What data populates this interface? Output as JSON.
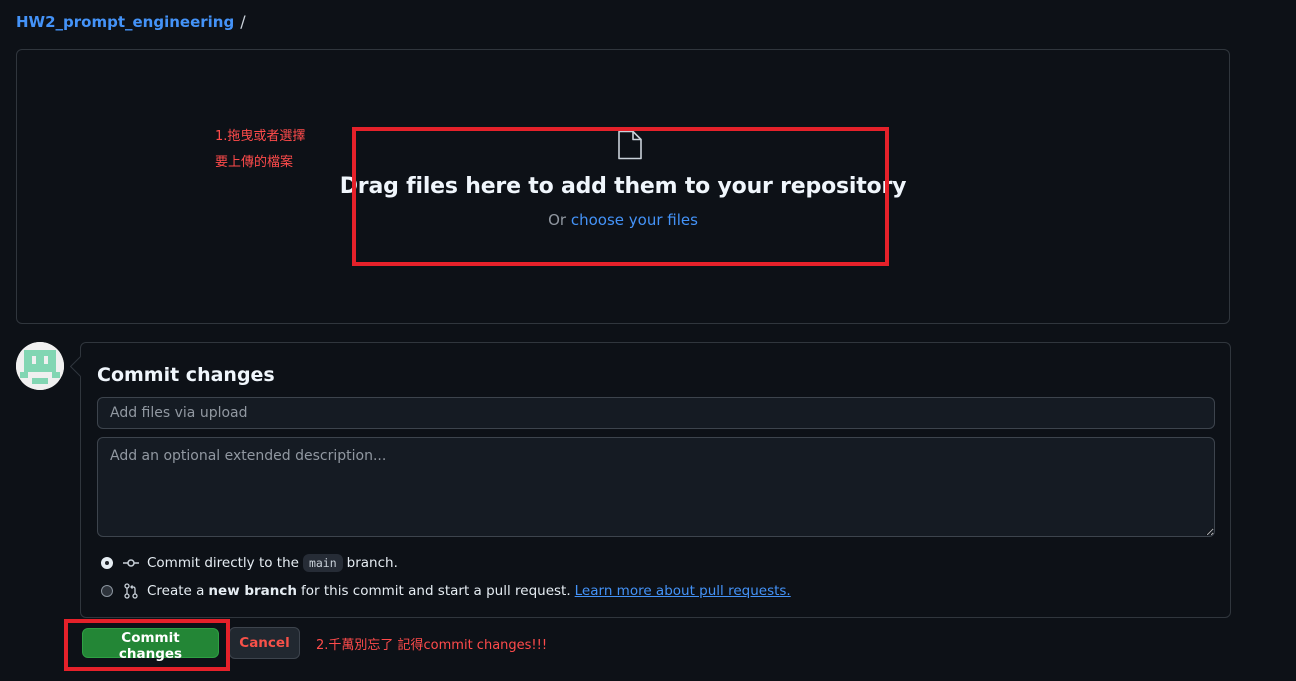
{
  "breadcrumb": {
    "repo": "HW2_prompt_engineering",
    "separator": "/"
  },
  "dropzone": {
    "title": "Drag files here to add them to your repository",
    "or_text": "Or",
    "choose_link": "choose your files",
    "icon": "file-icon"
  },
  "annotations": {
    "step1_line1": "1.拖曳或者選擇",
    "step1_line2": "要上傳的檔案",
    "step2": "2.千萬別忘了 記得commit changes!!!",
    "color": "#e5212a"
  },
  "commit": {
    "title": "Commit changes",
    "summary_placeholder": "Add files via upload",
    "description_placeholder": "Add an optional extended description...",
    "option_direct": {
      "prefix": "Commit directly to the",
      "branch": "main",
      "suffix": "branch.",
      "selected": true
    },
    "option_new_branch": {
      "prefix": "Create a",
      "bold": "new branch",
      "suffix": "for this commit and start a pull request.",
      "link": "Learn more about pull requests.",
      "selected": false
    },
    "submit_label": "Commit changes",
    "cancel_label": "Cancel"
  },
  "colors": {
    "background": "#0d1117",
    "link": "#4493f8",
    "primary_button": "#238636",
    "danger": "#f85149",
    "avatar": "#82d6b3"
  }
}
